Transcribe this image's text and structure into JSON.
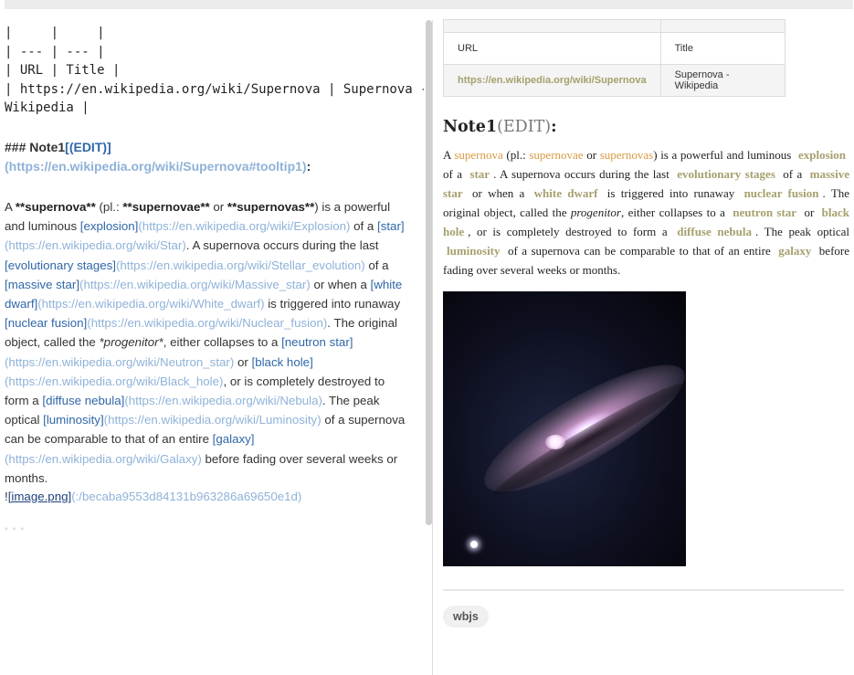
{
  "editor": {
    "table_lines": [
      "|     |     |",
      "| --- | --- |",
      "| URL | Title |",
      "| https://en.wikipedia.org/wiki/Supernova | Supernova -",
      "Wikipedia |"
    ],
    "heading_prefix": "### Note1",
    "heading_edit_label": "[(EDIT)]",
    "heading_edit_url": "(https://en.wikipedia.org/wiki/Supernova#tooltip1)",
    "heading_colon": ":",
    "para": {
      "t0": "A ",
      "b_supernova": "**supernova**",
      "t1": " (pl.: ",
      "b_supernovae": "**supernovae**",
      "t2": " or ",
      "b_supernovas": "**supernovas**",
      "t3": ") is a powerful and luminous ",
      "l_explosion": "[explosion]",
      "u_explosion": "(https://en.wikipedia.org/wiki/Explosion)",
      "t4": " of a ",
      "l_star": "[star]",
      "u_star": "(https://en.wikipedia.org/wiki/Star)",
      "t5": ". A supernova occurs during the last ",
      "l_evol": "[evolutionary stages]",
      "u_evol": "(https://en.wikipedia.org/wiki/Stellar_evolution)",
      "t6": " of a ",
      "l_massive": "[massive star]",
      "u_massive": "(https://en.wikipedia.org/wiki/Massive_star)",
      "t7": " or when a ",
      "l_wd": "[white dwarf]",
      "u_wd": "(https://en.wikipedia.org/wiki/White_dwarf)",
      "t8": " is triggered into runaway ",
      "l_nf": "[nuclear fusion]",
      "u_nf": "(https://en.wikipedia.org/wiki/Nuclear_fusion)",
      "t9": ". The original object, called the ",
      "i_prog": "*progenitor*",
      "t10": ", either collapses to a ",
      "l_ns": "[neutron star]",
      "u_ns": "(https://en.wikipedia.org/wiki/Neutron_star)",
      "t11": " or ",
      "l_bh": "[black hole]",
      "u_bh": "(https://en.wikipedia.org/wiki/Black_hole)",
      "t12": ", or is completely destroyed to form a ",
      "l_dn": "[diffuse nebula]",
      "u_dn": "(https://en.wikipedia.org/wiki/Nebula)",
      "t13": ". The peak optical ",
      "l_lum": "[luminosity]",
      "u_lum": "(https://en.wikipedia.org/wiki/Luminosity)",
      "t14": " of a supernova can be comparable to that of an entire ",
      "l_gal": "[galaxy]",
      "u_gal": "(https://en.wikipedia.org/wiki/Galaxy)",
      "t15": " before fading over several weeks or months."
    },
    "image_bang": "!",
    "image_label": "[image.png]",
    "image_url": "(:/becaba9553d84131b963286a69650e1d)",
    "hr": "* * *"
  },
  "preview": {
    "table": {
      "headers": [
        "URL",
        "Title"
      ],
      "row": [
        "https://en.wikipedia.org/wiki/Supernova",
        "Supernova - Wikipedia"
      ]
    },
    "heading": "Note1",
    "heading_edit": "(EDIT)",
    "heading_colon": ":",
    "para": {
      "t0": "A ",
      "supernova": "supernova",
      "t1": " (pl.: ",
      "supernovae": "supernovae",
      "t2": " or ",
      "supernovas": "supernovas",
      "t3": ") is a powerful and luminous ",
      "explosion": "explosion",
      "t4": " of a ",
      "star": "star",
      "t5": ". A supernova occurs during the last ",
      "evol": "evolutionary stages",
      "t6": " of a ",
      "massive": "massive star",
      "t7": " or when a ",
      "wd": "white dwarf",
      "t8": " is triggered into runaway ",
      "nf": "nuclear fusion",
      "t9": ". The original object, called the ",
      "prog": "progenitor",
      "t10": ", either collapses to a ",
      "ns": "neutron star",
      "t11": " or ",
      "bh": "black hole",
      "t12": ", or is completely destroyed to form a ",
      "dn": "diffuse nebula",
      "t13": ". The peak optical ",
      "lum": "luminosity",
      "t14": " of a supernova can be comparable to that of an entire ",
      "gal": "galaxy",
      "t15": " before fading over several weeks or months."
    },
    "tag": "wbjs"
  }
}
